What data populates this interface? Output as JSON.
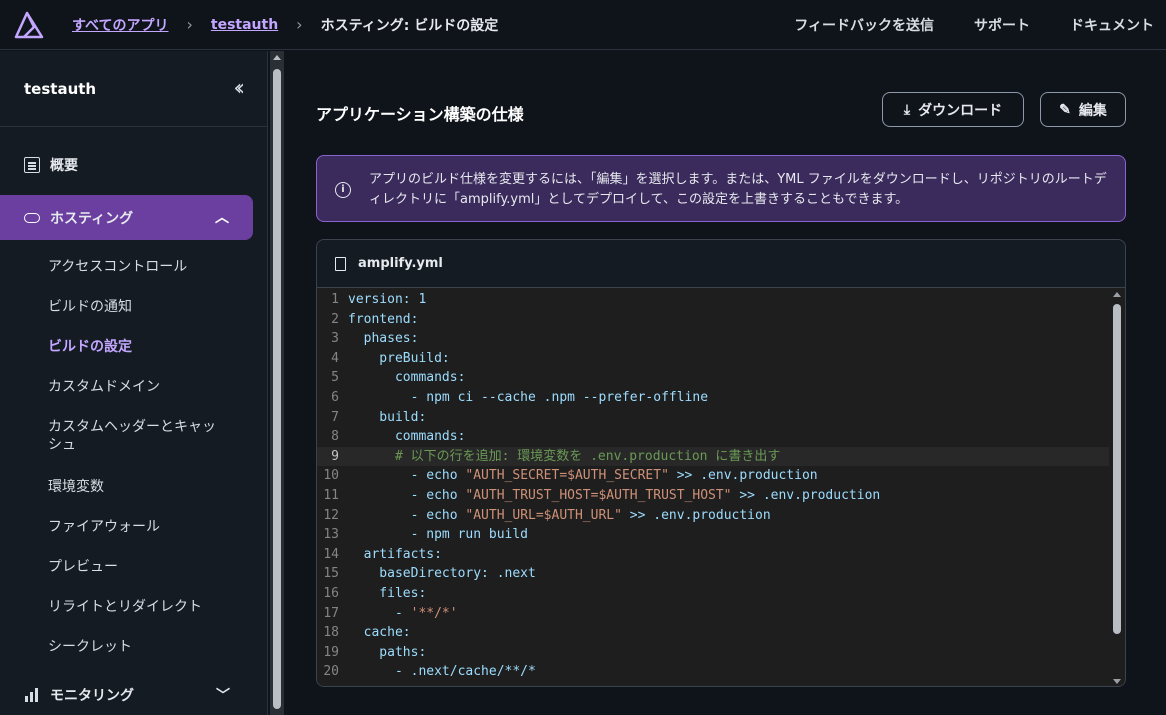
{
  "topbar": {
    "logo_icon": "amplify-logo-icon",
    "breadcrumbs": {
      "all_apps": "すべてのアプリ",
      "app": "testauth",
      "current": "ホスティング: ビルドの設定"
    },
    "links": {
      "feedback": "フィードバックを送信",
      "support": "サポート",
      "docs": "ドキュメント"
    }
  },
  "sidebar": {
    "title": "testauth",
    "collapse_icon": "double-chevron-left-icon",
    "overview": "概要",
    "hosting": "ホスティング",
    "hosting_items": [
      "アクセスコントロール",
      "ビルドの通知",
      "ビルドの設定",
      "カスタムドメイン",
      "カスタムヘッダーとキャッシュ",
      "環境変数",
      "ファイアウォール",
      "プレビュー",
      "リライトとリダイレクト",
      "シークレット"
    ],
    "active_item": "ビルドの設定",
    "monitoring": "モニタリング"
  },
  "main": {
    "title": "アプリケーション構築の仕様",
    "download_label": "ダウンロード",
    "edit_label": "編集",
    "info_text": "アプリのビルド仕様を変更するには、「編集」を選択します。または、YML ファイルをダウンロードし、リポジトリのルートディレクトリに「amplify.yml」としてデプロイして、この設定を上書きすることもできます。",
    "file_name": "amplify.yml",
    "current_line": 9,
    "code_lines": [
      "version: 1",
      "frontend:",
      "  phases:",
      "    preBuild:",
      "      commands:",
      "        - npm ci --cache .npm --prefer-offline",
      "    build:",
      "      commands:",
      "      # 以下の行を追加: 環境変数を .env.production に書き出す",
      "        - echo \"AUTH_SECRET=$AUTH_SECRET\" >> .env.production",
      "        - echo \"AUTH_TRUST_HOST=$AUTH_TRUST_HOST\" >> .env.production",
      "        - echo \"AUTH_URL=$AUTH_URL\" >> .env.production",
      "        - npm run build",
      "  artifacts:",
      "    baseDirectory: .next",
      "    files:",
      "      - '**/*'",
      "  cache:",
      "    paths:",
      "      - .next/cache/**/*"
    ]
  },
  "colors": {
    "accent": "#6b3fa0",
    "link": "#c3a6ff",
    "info_bg": "#3b2a5c"
  }
}
